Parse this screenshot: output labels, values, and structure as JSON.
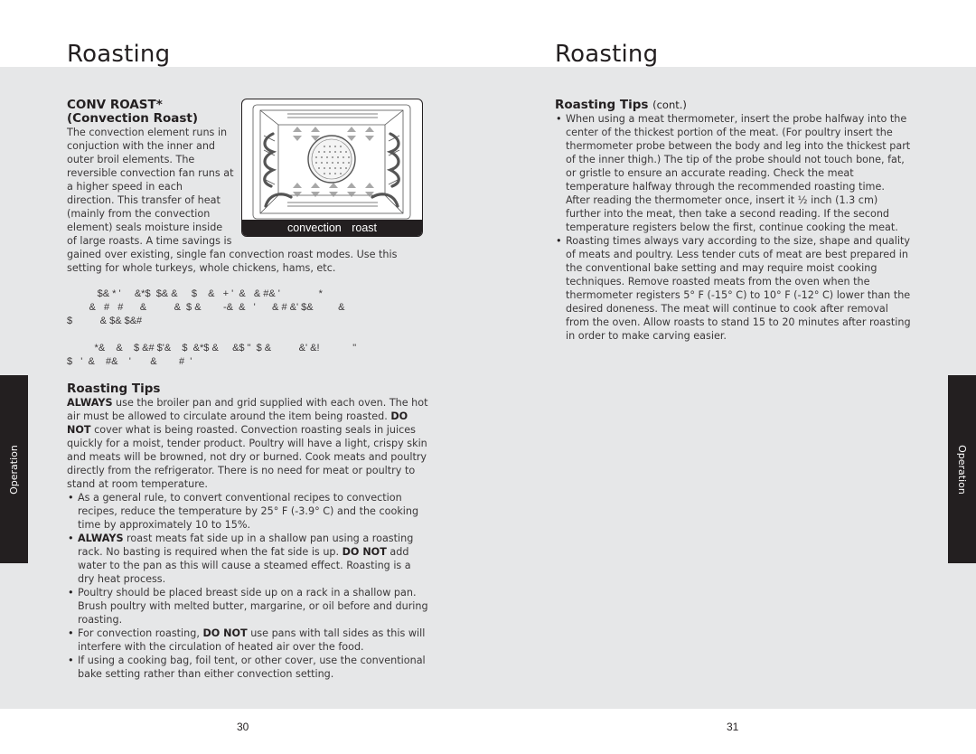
{
  "left_page": {
    "title": "Roasting",
    "conv_roast": {
      "heading_line1": "CONV ROAST*",
      "heading_line2": "(Convection Roast)",
      "body_lines": [
        "The convection element runs in",
        "conjuction with the inner and",
        "outer broil elements. The",
        "reversible convection fan runs at",
        "a higher speed in each",
        "direction. This transfer of heat",
        "(mainly from the convection",
        "element) seals moisture inside",
        "of large roasts. A time savings is"
      ],
      "body_continued": "gained over existing, single fan convection roast modes. Use this setting for whole turkeys, whole chickens, hams, etc."
    },
    "diagram": {
      "caption": "convection roast",
      "icon": "oven-convection-roast-diagram"
    },
    "garbled_lines_1": [
      "           $& * '     &*$  $& &     $    &   + '  &   & #& '              *",
      "        &   #   #      &          &  $ &        -&  &   '      & # &' $&         &",
      "$          & $& $&#"
    ],
    "garbled_lines_2": [
      "          *&    &    $ &# $'&    $  &*$ &     &$ \"  $ &          &' &!            \"",
      "$   '  &    #&    '       &        #  '"
    ],
    "roasting_tips": {
      "heading": "Roasting Tips",
      "intro": [
        {
          "bold": "ALWAYS",
          "text": " use the broiler pan and grid supplied with each oven. The hot air must be allowed to circulate around the item being roasted."
        },
        {
          "bold": "DO NOT",
          "text": " cover what is being roasted. Convection roasting seals in juices quickly for a moist, tender product. Poultry will have a light, crispy skin and meats will be browned, not dry or burned. Cook meats and poultry directly from the refrigerator. There is no need for meat or poultry to stand at room temperature."
        }
      ],
      "bullets": [
        {
          "pre": "As a general rule, to convert conventional recipes to convection recipes, reduce the temperature by 25° F (-3.9° C) and the cooking time by approximately 10 to 15%.",
          "b1": "",
          "mid": "",
          "b2": "",
          "post": ""
        },
        {
          "pre": "",
          "b1": "ALWAYS",
          "mid": " roast meats fat side up in a shallow pan using a roasting rack. No basting is required when the fat side is up. ",
          "b2": "DO NOT",
          "post": " add water to the pan as this will cause a steamed effect. Roasting is a dry heat process."
        },
        {
          "pre": "Poultry should be placed breast side up on a rack in a shallow pan. Brush poultry with melted butter, margarine, or oil before and during roasting.",
          "b1": "",
          "mid": "",
          "b2": "",
          "post": ""
        },
        {
          "pre": "For convection roasting, ",
          "b1": "DO NOT",
          "mid": " use pans with tall sides as this will interfere with the circulation of heated air over the food.",
          "b2": "",
          "post": ""
        },
        {
          "pre": "If using a cooking bag, foil tent, or other cover, use the conventional bake setting rather than either convection setting.",
          "b1": "",
          "mid": "",
          "b2": "",
          "post": ""
        }
      ]
    },
    "side_tab": "Operation",
    "page_number": "30"
  },
  "right_page": {
    "title": "Roasting",
    "roasting_tips_cont": {
      "heading": "Roasting Tips",
      "heading_suffix": "(cont.)",
      "bullets": [
        "When using a meat thermometer, insert the probe halfway into the center of the thickest portion of the meat. (For poultry insert the thermometer probe between the body and leg into the thickest part of the inner thigh.) The tip of the probe should not touch bone, fat, or gristle to ensure an accurate reading. Check the meat temperature halfway through the recommended roasting time. After reading the thermometer once, insert it ½ inch (1.3 cm) further into the meat, then take a second reading. If the second temperature registers below the first, continue cooking the meat.",
        "Roasting times always vary according to the size, shape and quality of meats and poultry. Less tender cuts of meat are best prepared in the conventional bake setting and may require moist cooking techniques. Remove roasted meats from the oven when the thermometer registers 5° F (-15° C) to 10° F (-12° C) lower than the desired doneness. The meat will continue to cook after removal from the oven. Allow roasts to stand 15 to 20 minutes after roasting in order to make carving easier."
      ]
    },
    "side_tab": "Operation",
    "page_number": "31"
  }
}
